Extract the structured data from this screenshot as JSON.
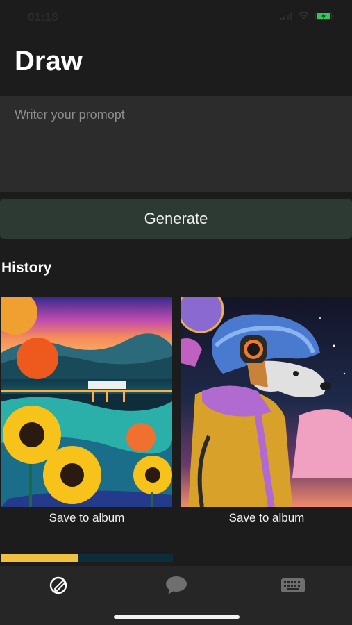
{
  "status_bar": {
    "time": "01:18"
  },
  "header": {
    "title": "Draw"
  },
  "prompt": {
    "placeholder": "Writer your promopt",
    "value": ""
  },
  "generate": {
    "label": "Generate"
  },
  "history": {
    "title": "History",
    "items": [
      {
        "image": "sunflower-landscape-artwork",
        "save_label": "Save to album"
      },
      {
        "image": "dog-in-hoodie-artwork",
        "save_label": "Save to album"
      }
    ]
  },
  "tab_bar": {
    "tabs": [
      {
        "icon": "draw-icon",
        "active": true
      },
      {
        "icon": "chat-bubble-icon",
        "active": false
      },
      {
        "icon": "keyboard-icon",
        "active": false
      }
    ]
  },
  "colors": {
    "background": "#1c1c1c",
    "input_bg": "#2c2c2c",
    "button_bg": "#2d3a33",
    "accent_green": "#34c759"
  }
}
